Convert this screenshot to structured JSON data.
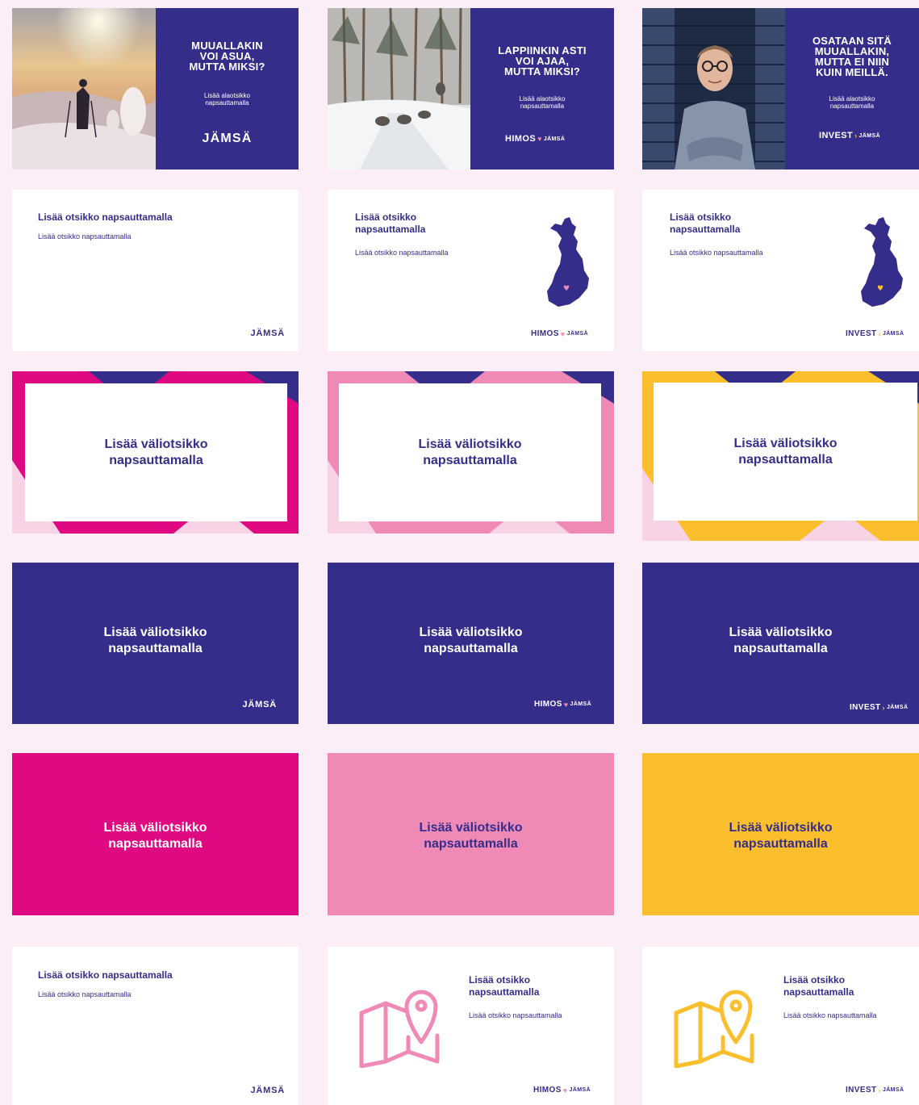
{
  "colors": {
    "navy": "#352d8a",
    "magenta": "#df0a82",
    "pink": "#ef8ab7",
    "light_pink": "#f8d3e5",
    "yellow": "#fbbf2d",
    "white": "#ffffff",
    "background": "#fbeef6"
  },
  "logos": {
    "jamsa": "JÄMSÄ",
    "himos": "HIMOS",
    "invest": "INVEST",
    "jamsa_small": "JÄMSÄ",
    "heart_icon": "♥",
    "arrow_icon": "›"
  },
  "covers": [
    {
      "title": "MUUALLAKIN\nVOI ASUA,\nMUTTA MIKSI?",
      "subtitle": "Lisää alaotsikko\nnapsauttamalla",
      "photo": "snowy-hiker-photo"
    },
    {
      "title": "LAPPIINKIN ASTI\nVOI AJAA,\nMUTTA MIKSI?",
      "subtitle": "Lisää alaotsikko\nnapsauttamalla",
      "photo": "husky-sled-photo"
    },
    {
      "title": "OSATAAN SITÄ\nMUUALLAKIN,\nMUTTA EI NIIN\nKUIN MEILLÄ.",
      "subtitle": "Lisää alaotsikko\nnapsauttamalla",
      "photo": "man-with-glasses-photo"
    }
  ],
  "title_slides": [
    {
      "title": "Lisää otsikko napsauttamalla",
      "subtitle": "Lisää otsikko napsauttamalla"
    },
    {
      "title": "Lisää otsikko\nnapsauttamalla",
      "subtitle": "Lisää otsikko napsauttamalla",
      "map_icon": "finland-map-icon"
    },
    {
      "title": "Lisää otsikko\nnapsauttamalla",
      "subtitle": "Lisää otsikko napsauttamalla",
      "map_icon": "finland-map-icon"
    }
  ],
  "section_title": "Lisää väliotsikko\nnapsauttamalla",
  "final_slides": [
    {
      "title": "Lisää otsikko napsauttamalla",
      "subtitle": "Lisää otsikko napsauttamalla"
    },
    {
      "title": "Lisää otsikko\nnapsauttamalla",
      "subtitle": "Lisää otsikko napsauttamalla",
      "icon": "map-pin-icon"
    },
    {
      "title": "Lisää otsikko\nnapsauttamalla",
      "subtitle": "Lisää otsikko napsauttamalla",
      "icon": "map-pin-icon"
    }
  ]
}
